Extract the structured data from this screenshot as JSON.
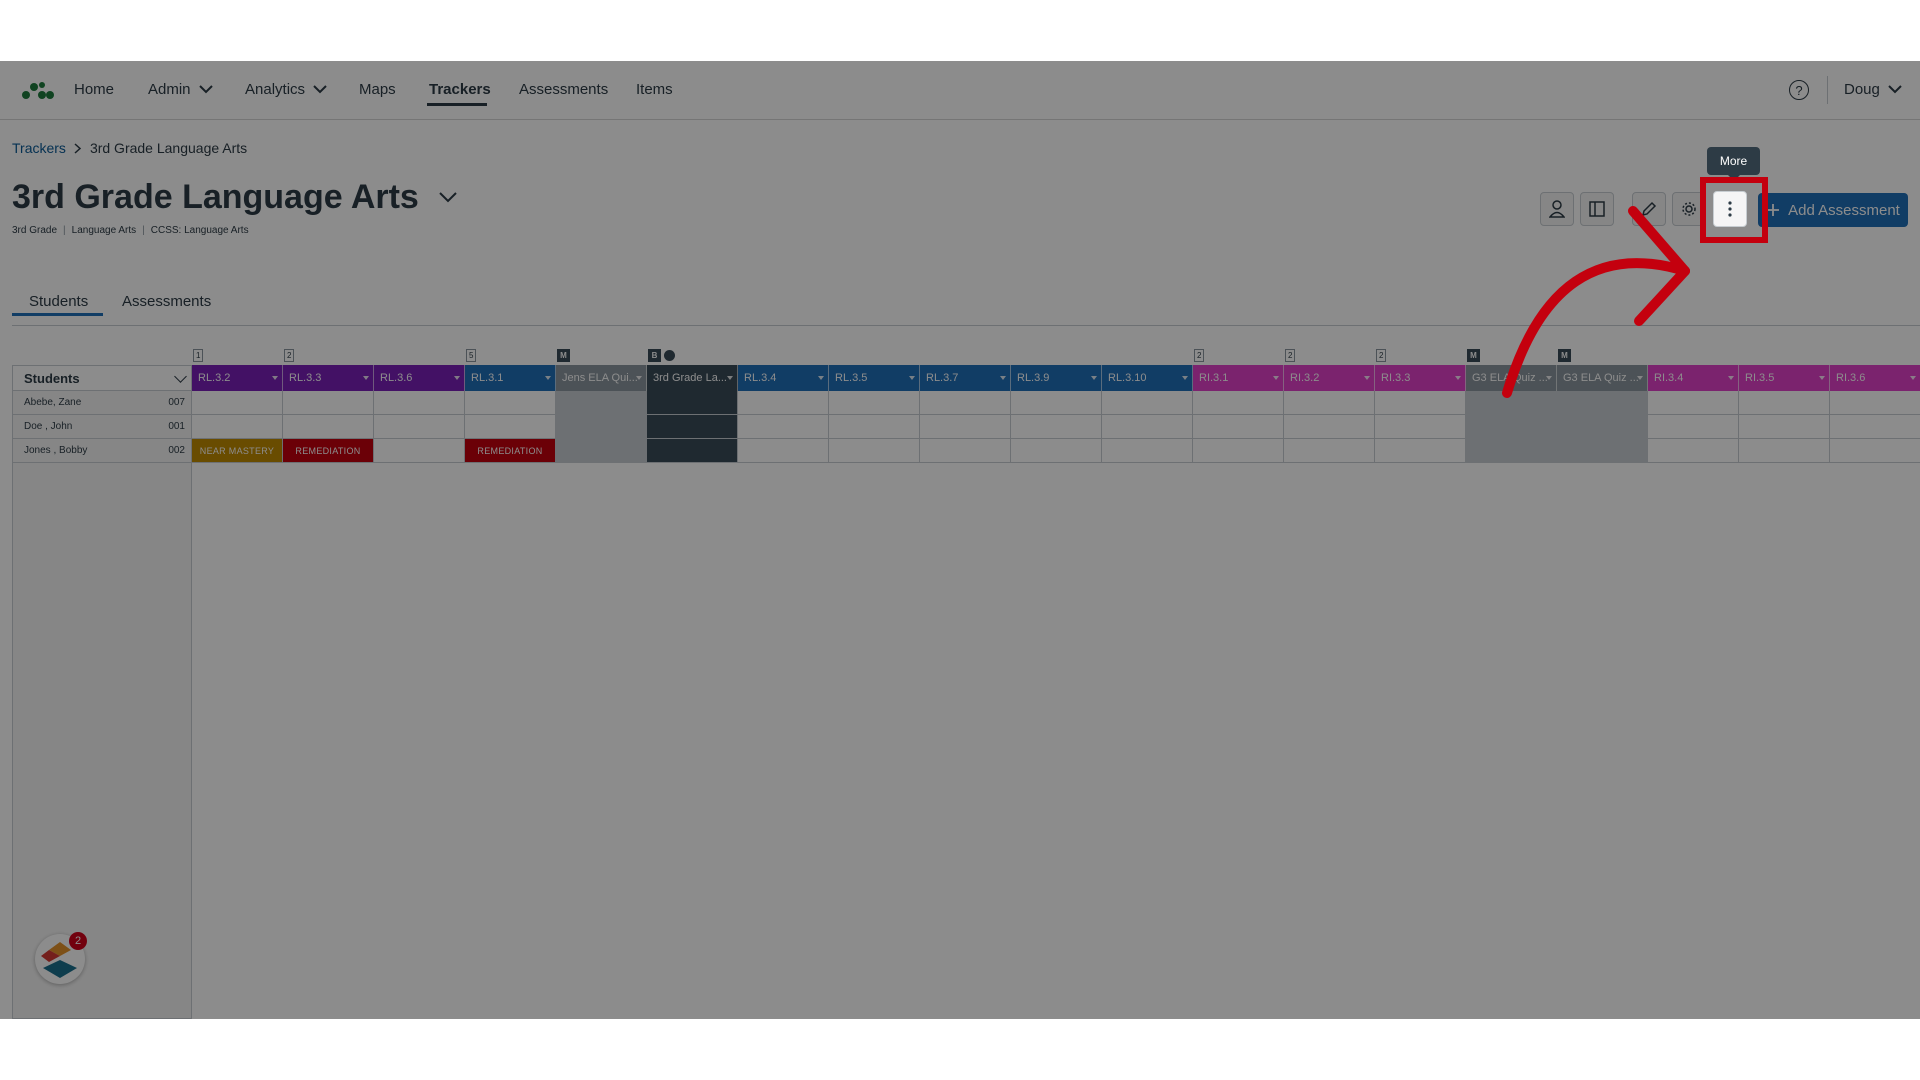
{
  "nav": {
    "items": [
      {
        "label": "Home"
      },
      {
        "label": "Admin"
      },
      {
        "label": "Analytics"
      },
      {
        "label": "Maps"
      },
      {
        "label": "Trackers"
      },
      {
        "label": "Assessments"
      },
      {
        "label": "Items"
      }
    ],
    "help": "?",
    "user": "Doug"
  },
  "breadcrumb": {
    "root": "Trackers",
    "current": "3rd Grade Language Arts"
  },
  "page": {
    "title": "3rd Grade Language Arts",
    "tags": [
      "3rd Grade",
      "Language Arts",
      "CCSS: Language Arts"
    ]
  },
  "toolbar": {
    "tooltip": "More",
    "add_label": "Add Assessment"
  },
  "tabs": [
    {
      "label": "Students"
    },
    {
      "label": "Assessments"
    }
  ],
  "students_header": "Students",
  "students": [
    {
      "name": "Abebe, Zane",
      "id": "007"
    },
    {
      "name": "Doe , John",
      "id": "001"
    },
    {
      "name": "Jones , Bobby",
      "id": "002"
    }
  ],
  "columns": [
    {
      "label": "RL.3.2",
      "badge": "1",
      "color": "#7a1fb8"
    },
    {
      "label": "RL.3.3",
      "badge": "2",
      "color": "#7a1fb8"
    },
    {
      "label": "RL.3.6",
      "badge": "",
      "color": "#7a1fb8"
    },
    {
      "label": "RL.3.1",
      "badge": "5",
      "color": "#1f6fb8"
    },
    {
      "label": "Jens ELA Qui...",
      "badge": "M",
      "color": "#8b969e"
    },
    {
      "label": "3rd Grade La...",
      "badge": "B",
      "color": "#394b58"
    },
    {
      "label": "RL.3.4",
      "badge": "",
      "color": "#1f6fb8"
    },
    {
      "label": "RL.3.5",
      "badge": "",
      "color": "#1f6fb8"
    },
    {
      "label": "RL.3.7",
      "badge": "",
      "color": "#1f6fb8"
    },
    {
      "label": "RL.3.9",
      "badge": "",
      "color": "#1f6fb8"
    },
    {
      "label": "RL.3.10",
      "badge": "",
      "color": "#1f6fb8"
    },
    {
      "label": "RI.3.1",
      "badge": "2",
      "color": "#e040c8"
    },
    {
      "label": "RI.3.2",
      "badge": "2",
      "color": "#e040c8"
    },
    {
      "label": "RI.3.3",
      "badge": "2",
      "color": "#e040c8"
    },
    {
      "label": "G3 ELA Quiz ...",
      "badge": "M",
      "color": "#8b969e"
    },
    {
      "label": "G3 ELA Quiz ...",
      "badge": "M",
      "color": "#8b969e"
    },
    {
      "label": "RI.3.4",
      "badge": "",
      "color": "#e040c8"
    },
    {
      "label": "RI.3.5",
      "badge": "",
      "color": "#e040c8"
    },
    {
      "label": "RI.3.6",
      "badge": "",
      "color": "#e040c8"
    }
  ],
  "mastery": [
    {
      "row": 2,
      "col": 0,
      "label": "NEAR MASTERY",
      "color": "#c08a00"
    },
    {
      "row": 2,
      "col": 1,
      "label": "REMEDIATION",
      "color": "#c4000e"
    },
    {
      "row": 2,
      "col": 3,
      "label": "REMEDIATION",
      "color": "#c4000e"
    }
  ],
  "launcher_count": "2",
  "colors": {
    "highlight": "#c4000e",
    "primary": "#1f6fb8"
  }
}
